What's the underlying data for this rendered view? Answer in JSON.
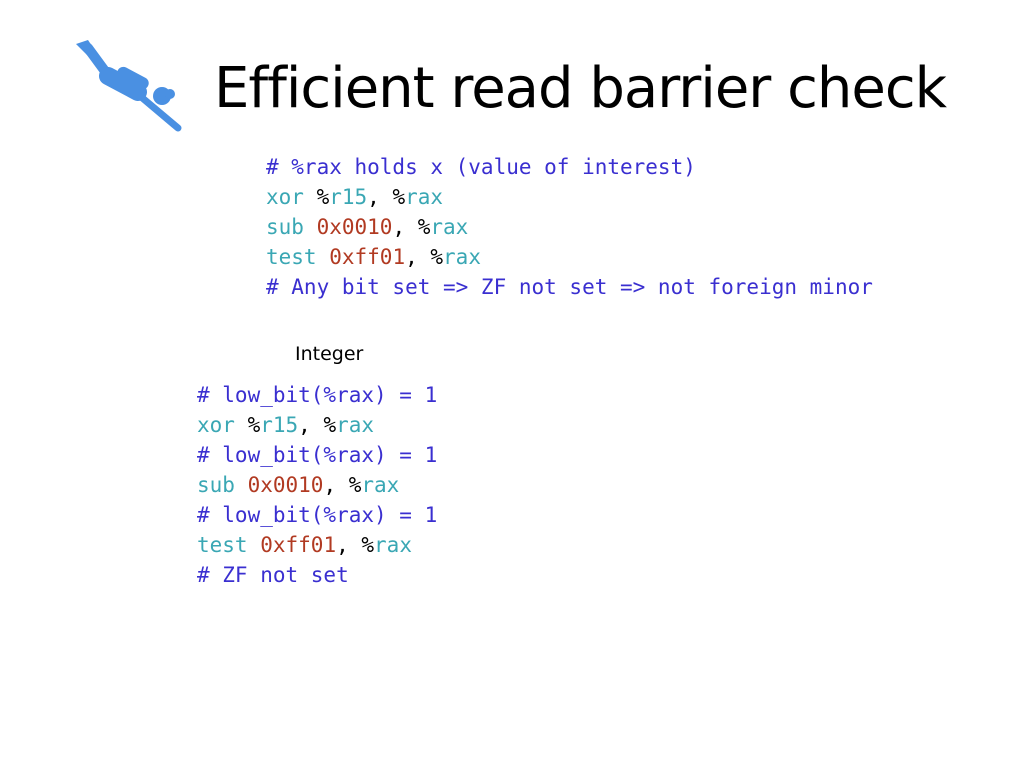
{
  "title": "Efficient read barrier check",
  "icon": "scuba-diver-icon",
  "colors": {
    "comment": "#3a2fd0",
    "keyword": "#3aa7b4",
    "number": "#b13a22",
    "icon": "#4a90e2"
  },
  "code_top": [
    [
      {
        "t": "comment",
        "v": "# %rax holds x (value of interest)"
      }
    ],
    [
      {
        "t": "op",
        "v": "xor"
      },
      {
        "t": "plain",
        "v": " %"
      },
      {
        "t": "reg",
        "v": "r15"
      },
      {
        "t": "plain",
        "v": ", %"
      },
      {
        "t": "reg",
        "v": "rax"
      }
    ],
    [
      {
        "t": "op",
        "v": "sub"
      },
      {
        "t": "plain",
        "v": " "
      },
      {
        "t": "num",
        "v": "0x0010"
      },
      {
        "t": "plain",
        "v": ", %"
      },
      {
        "t": "reg",
        "v": "rax"
      }
    ],
    [
      {
        "t": "op",
        "v": "test"
      },
      {
        "t": "plain",
        "v": " "
      },
      {
        "t": "num",
        "v": "0xff01"
      },
      {
        "t": "plain",
        "v": ", %"
      },
      {
        "t": "reg",
        "v": "rax"
      }
    ],
    [
      {
        "t": "comment",
        "v": "# Any bit set => ZF not set => not foreign minor"
      }
    ]
  ],
  "section_label": "Integer",
  "code_bottom": [
    [
      {
        "t": "comment",
        "v": "# low_bit(%rax) = 1"
      }
    ],
    [
      {
        "t": "op",
        "v": "xor"
      },
      {
        "t": "plain",
        "v": " %"
      },
      {
        "t": "reg",
        "v": "r15"
      },
      {
        "t": "plain",
        "v": ", %"
      },
      {
        "t": "reg",
        "v": "rax"
      }
    ],
    [
      {
        "t": "comment",
        "v": "# low_bit(%rax) = 1"
      }
    ],
    [
      {
        "t": "op",
        "v": "sub"
      },
      {
        "t": "plain",
        "v": " "
      },
      {
        "t": "num",
        "v": "0x0010"
      },
      {
        "t": "plain",
        "v": ", %"
      },
      {
        "t": "reg",
        "v": "rax"
      }
    ],
    [
      {
        "t": "comment",
        "v": "# low_bit(%rax) = 1"
      }
    ],
    [
      {
        "t": "op",
        "v": "test"
      },
      {
        "t": "plain",
        "v": " "
      },
      {
        "t": "num",
        "v": "0xff01"
      },
      {
        "t": "plain",
        "v": ", %"
      },
      {
        "t": "reg",
        "v": "rax"
      }
    ],
    [
      {
        "t": "comment",
        "v": "# ZF not set"
      }
    ]
  ]
}
